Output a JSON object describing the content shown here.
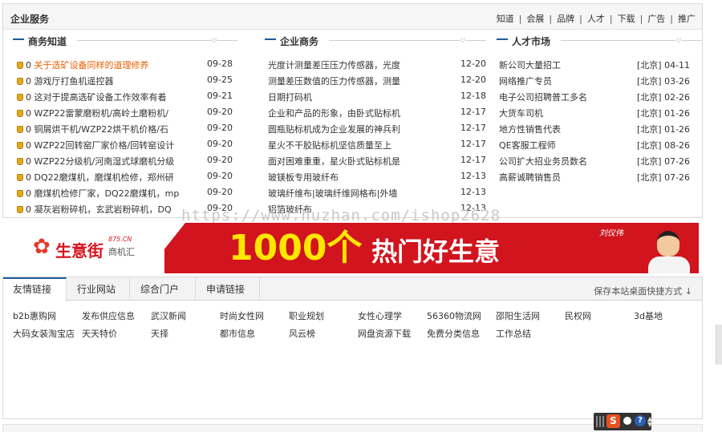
{
  "service": {
    "title": "企业服务",
    "nav": [
      "知道",
      "会展",
      "品牌",
      "人才",
      "下载",
      "广告",
      "推广"
    ]
  },
  "knowledge": {
    "title": "商务知道",
    "items": [
      {
        "count": "0",
        "text": "关于选矿设备同样的道理修养",
        "date": "09-28",
        "highlight": true
      },
      {
        "count": "0",
        "text": "游戏厅打鱼机遥控器",
        "date": "09-25"
      },
      {
        "count": "0",
        "text": "这对于提高选矿设备工作效率有着",
        "date": "09-21"
      },
      {
        "count": "0",
        "text": "WZP22雷蒙磨粉机/高岭土磨粉机/",
        "date": "09-20"
      },
      {
        "count": "0",
        "text": "铜屑烘干机/WZP22烘干机价格/石",
        "date": "09-20"
      },
      {
        "count": "0",
        "text": "WZP22回转窑厂家价格/回转窑设计",
        "date": "09-20"
      },
      {
        "count": "0",
        "text": "WZP22分级机/河南湿式球磨机分级",
        "date": "09-20"
      },
      {
        "count": "0",
        "text": "DQ22磨煤机，磨煤机检修，郑州研",
        "date": "09-20"
      },
      {
        "count": "0",
        "text": "磨煤机检修厂家，DQ22磨煤机，mp",
        "date": "09-20"
      },
      {
        "count": "0",
        "text": "凝灰岩粉碎机，玄武岩粉碎机，DQ",
        "date": "09-20"
      }
    ]
  },
  "business": {
    "title": "企业商务",
    "items": [
      {
        "text": "光度计测量差压压力传感器，光度",
        "date": "12-20"
      },
      {
        "text": "测量差压数值的压力传感器，测量",
        "date": "12-20"
      },
      {
        "text": "日期打码机",
        "date": "12-18"
      },
      {
        "text": "企业和产品的形象，由卧式贴标机",
        "date": "12-17"
      },
      {
        "text": "圆瓶贴标机成为企业发展的神兵利",
        "date": "12-17"
      },
      {
        "text": "星火不干胶贴标机坚信质量至上",
        "date": "12-17"
      },
      {
        "text": "面对困难重重，星火卧式贴标机是",
        "date": "12-17"
      },
      {
        "text": "玻镁板专用玻纤布",
        "date": "12-13"
      },
      {
        "text": "玻璃纤维布|玻璃纤维网格布|外墙",
        "date": "12-13"
      },
      {
        "text": "铝箔玻纤布",
        "date": "12-13"
      }
    ]
  },
  "talent": {
    "title": "人才市场",
    "items": [
      {
        "text": "新公司大量招工",
        "region": "[北京]",
        "date": "04-11"
      },
      {
        "text": "网络推广专员",
        "region": "[北京]",
        "date": "03-26"
      },
      {
        "text": "电子公司招聘普工多名",
        "region": "[北京]",
        "date": "02-26"
      },
      {
        "text": "大货车司机",
        "region": "[北京]",
        "date": "01-26"
      },
      {
        "text": "地方性销售代表",
        "region": "[北京]",
        "date": "01-26"
      },
      {
        "text": "QE客服工程师",
        "region": "[北京]",
        "date": "08-26"
      },
      {
        "text": "公司扩大招业务员数名",
        "region": "[北京]",
        "date": "07-26"
      },
      {
        "text": "高薪诚聘销售员",
        "region": "[北京]",
        "date": "07-26"
      }
    ]
  },
  "watermark": "https://www.huzhan.com/ishop2628",
  "banner": {
    "logo_name": "生意街",
    "logo_domain": "875.CN",
    "logo_sub": "商机汇",
    "headline_number": "1000个",
    "headline_text": "热门好生意",
    "person_name": "刘仪伟"
  },
  "links": {
    "tabs": [
      "友情链接",
      "行业网站",
      "综合门户",
      "申请链接"
    ],
    "active_tab": 0,
    "save_label": "保存本站桌面快捷方式 ↓",
    "rows": [
      [
        "b2b惠购网",
        "发布供应信息",
        "武汉新闻",
        "时尚女性网",
        "职业规划",
        "女性心理学",
        "56360物流网",
        "邵阳生活网",
        "民权网",
        "3d基地"
      ],
      [
        "大码女装淘宝店",
        "天天特价",
        "天择",
        "都市信息",
        "风云榜",
        "网盘资源下载",
        "免费分类信息",
        "工作总结"
      ]
    ]
  },
  "tray": {
    "s_label": "S",
    "help_label": "?"
  }
}
